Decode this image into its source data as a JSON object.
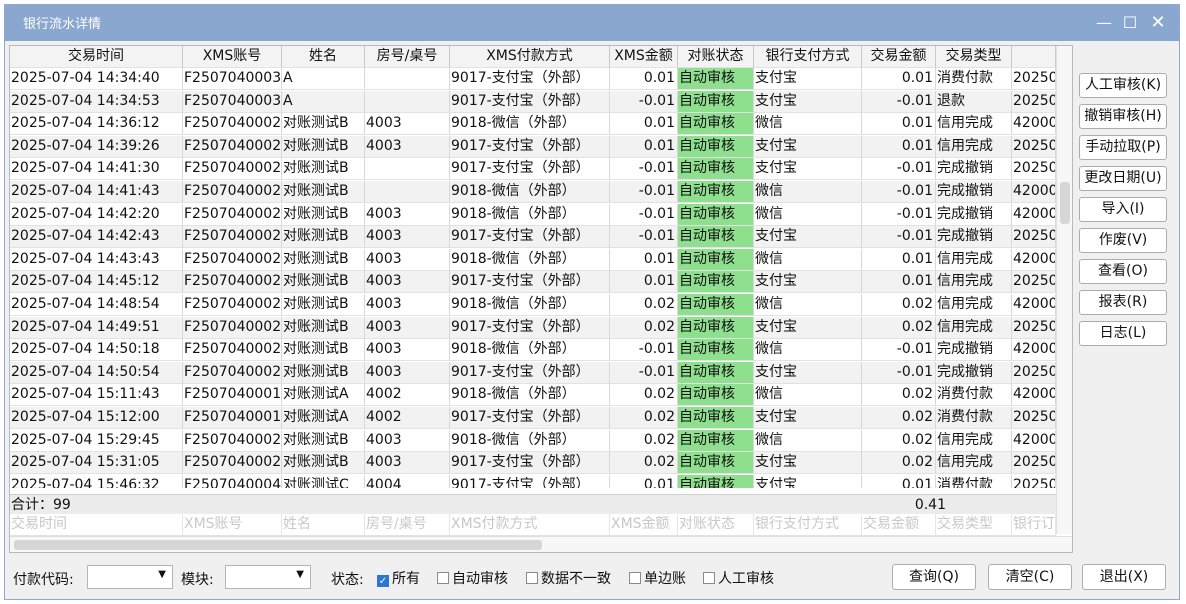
{
  "window": {
    "title": "银行流水详情",
    "controls": {
      "minimize": "—",
      "maximize": "☐",
      "close": "✕"
    }
  },
  "grid": {
    "columns": [
      "交易时间",
      "XMS账号",
      "姓名",
      "房号/桌号",
      "XMS付款方式",
      "XMS金额",
      "对账状态",
      "银行支付方式",
      "交易金额",
      "交易类型",
      ""
    ],
    "rows": [
      [
        "2025-07-04 14:34:40",
        "F2507040003",
        "A",
        "",
        "9017-支付宝（外部）",
        "0.01",
        "自动审核",
        "支付宝",
        "0.01",
        "消费付款",
        "20250"
      ],
      [
        "2025-07-04 14:34:53",
        "F2507040003",
        "A",
        "",
        "9017-支付宝（外部）",
        "-0.01",
        "自动审核",
        "支付宝",
        "-0.01",
        "退款",
        "20250"
      ],
      [
        "2025-07-04 14:36:12",
        "F2507040002",
        "对账测试B",
        "4003",
        "9018-微信（外部）",
        "0.01",
        "自动审核",
        "微信",
        "0.01",
        "信用完成",
        "42000"
      ],
      [
        "2025-07-04 14:39:26",
        "F2507040002",
        "对账测试B",
        "4003",
        "9017-支付宝（外部）",
        "0.01",
        "自动审核",
        "支付宝",
        "0.01",
        "信用完成",
        "20250"
      ],
      [
        "2025-07-04 14:41:30",
        "F2507040002",
        "对账测试B",
        "",
        "9017-支付宝（外部）",
        "-0.01",
        "自动审核",
        "支付宝",
        "-0.01",
        "完成撤销",
        "20250"
      ],
      [
        "2025-07-04 14:41:43",
        "F2507040002",
        "对账测试B",
        "",
        "9018-微信（外部）",
        "-0.01",
        "自动审核",
        "微信",
        "-0.01",
        "完成撤销",
        "42000"
      ],
      [
        "2025-07-04 14:42:20",
        "F2507040002",
        "对账测试B",
        "4003",
        "9018-微信（外部）",
        "-0.01",
        "自动审核",
        "微信",
        "-0.01",
        "完成撤销",
        "42000"
      ],
      [
        "2025-07-04 14:42:43",
        "F2507040002",
        "对账测试B",
        "4003",
        "9017-支付宝（外部）",
        "-0.01",
        "自动审核",
        "支付宝",
        "-0.01",
        "完成撤销",
        "20250"
      ],
      [
        "2025-07-04 14:43:43",
        "F2507040002",
        "对账测试B",
        "4003",
        "9018-微信（外部）",
        "0.01",
        "自动审核",
        "微信",
        "0.01",
        "信用完成",
        "42000"
      ],
      [
        "2025-07-04 14:45:12",
        "F2507040002",
        "对账测试B",
        "4003",
        "9017-支付宝（外部）",
        "0.01",
        "自动审核",
        "支付宝",
        "0.01",
        "信用完成",
        "20250"
      ],
      [
        "2025-07-04 14:48:54",
        "F2507040002",
        "对账测试B",
        "4003",
        "9018-微信（外部）",
        "0.02",
        "自动审核",
        "微信",
        "0.02",
        "信用完成",
        "42000"
      ],
      [
        "2025-07-04 14:49:51",
        "F2507040002",
        "对账测试B",
        "4003",
        "9017-支付宝（外部）",
        "0.02",
        "自动审核",
        "支付宝",
        "0.02",
        "信用完成",
        "20250"
      ],
      [
        "2025-07-04 14:50:18",
        "F2507040002",
        "对账测试B",
        "4003",
        "9018-微信（外部）",
        "-0.01",
        "自动审核",
        "微信",
        "-0.01",
        "完成撤销",
        "42000"
      ],
      [
        "2025-07-04 14:50:54",
        "F2507040002",
        "对账测试B",
        "4003",
        "9017-支付宝（外部）",
        "-0.01",
        "自动审核",
        "支付宝",
        "-0.01",
        "完成撤销",
        "20250"
      ],
      [
        "2025-07-04 15:11:43",
        "F2507040001",
        "对账测试A",
        "4002",
        "9018-微信（外部）",
        "0.02",
        "自动审核",
        "微信",
        "0.02",
        "消费付款",
        "42000"
      ],
      [
        "2025-07-04 15:12:00",
        "F2507040001",
        "对账测试A",
        "4002",
        "9017-支付宝（外部）",
        "0.02",
        "自动审核",
        "支付宝",
        "0.02",
        "消费付款",
        "20250"
      ],
      [
        "2025-07-04 15:29:45",
        "F2507040002",
        "对账测试B",
        "4003",
        "9018-微信（外部）",
        "0.02",
        "自动审核",
        "微信",
        "0.02",
        "信用完成",
        "42000"
      ],
      [
        "2025-07-04 15:31:05",
        "F2507040002",
        "对账测试B",
        "4003",
        "9017-支付宝（外部）",
        "0.02",
        "自动审核",
        "支付宝",
        "0.02",
        "信用完成",
        "20250"
      ],
      [
        "2025-07-04 15:46:32",
        "F2507040004",
        "对账测试C",
        "4004",
        "9017-支付宝（外部）",
        "0.01",
        "自动审核",
        "支付宝",
        "0.01",
        "消费付款",
        "20250"
      ]
    ],
    "summary": {
      "count_label": "合计：99",
      "total_amount": "0.41"
    },
    "filter_placeholders": [
      "交易时间",
      "XMS账号",
      "姓名",
      "房号/桌号",
      "XMS付款方式",
      "XMS金额",
      "对账状态",
      "银行支付方式",
      "交易金额",
      "交易类型",
      "银行订"
    ]
  },
  "side_buttons": [
    "人工审核(K)",
    "撤销审核(H)",
    "手动拉取(P)",
    "更改日期(U)",
    "导入(I)",
    "作废(V)",
    "查看(O)",
    "报表(R)",
    "日志(L)"
  ],
  "filters": {
    "pay_code_label": "付款代码:",
    "pay_code_value": "",
    "module_label": "模块:",
    "module_value": "",
    "status_label": "状态:",
    "options": [
      {
        "label": "所有",
        "checked": true
      },
      {
        "label": "自动审核",
        "checked": false
      },
      {
        "label": "数据不一致",
        "checked": false
      },
      {
        "label": "单边账",
        "checked": false
      },
      {
        "label": "人工审核",
        "checked": false
      }
    ]
  },
  "actions": {
    "query": "查询(Q)",
    "clear": "清空(C)",
    "exit": "退出(X)"
  },
  "colors": {
    "titlebar": "#8aa7d0",
    "status_auto": "#8ee08e",
    "checkbox_on": "#2a76d2"
  }
}
